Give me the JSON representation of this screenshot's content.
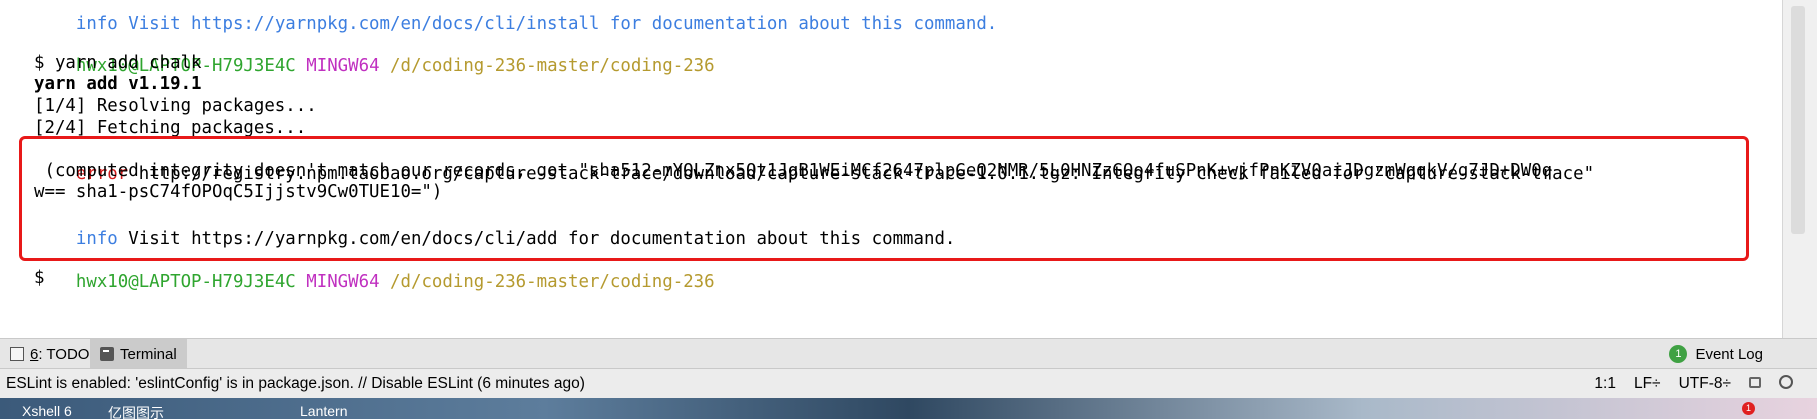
{
  "terminal": {
    "top_partial_line": "info Visit https://yarnpkg.com/en/docs/cli/install for documentation about this command.",
    "prompt1": {
      "user": "hwx10@LAPTOP-H79J3E4C",
      "shell": "MINGW64",
      "path": "/d/coding-236-master/coding-236"
    },
    "command": "$ yarn add chalk",
    "version": "yarn add v1.19.1",
    "step1": "[1/4] Resolving packages...",
    "step2": "[2/4] Fetching packages...",
    "error_label": "error",
    "error_text": " http://registry.npm.taobao.org/capture-stack-trace/download/capture-stack-trace-1.0.1.tgz: Integrity check failed for \"capture-stack-trace\"",
    "error_line2": " (computed integrity doesn't match our records, got \"sha512-mYQLZnx5Qt1JgB1WEiMCf2647plpGeQ2NMR/5L0HNZzGQo4fuSPnK+wjfPnKZV0aiJDgzmWqqkV/g7JD+DW0q",
    "error_line3": "w== sha1-psC74fOPOqC5Ijjstv9Cw0TUE10=\")",
    "info_label": "info",
    "info_text": " Visit https://yarnpkg.com/en/docs/cli/add for documentation about this command.",
    "prompt2": {
      "user": "hwx10@LAPTOP-H79J3E4C",
      "shell": "MINGW64",
      "path": "/d/coding-236-master/coding-236"
    },
    "cursor_prompt": "$"
  },
  "toolwindows": {
    "todo_num": "6",
    "todo_label": ": TODO",
    "terminal_label": "Terminal",
    "event_badge": "1",
    "event_label": "Event Log"
  },
  "statusbar": {
    "message": "ESLint is enabled: 'eslintConfig' is in package.json. // Disable ESLint (6 minutes ago)",
    "position": "1:1",
    "line_sep": "LF÷",
    "encoding": "UTF-8÷"
  },
  "taskbar": {
    "items": [
      "Xshell 6",
      "亿图图示",
      "Lantern"
    ],
    "notif": "1"
  },
  "colors": {
    "prompt_user": "#2fa52f",
    "prompt_shell": "#c030c0",
    "prompt_path": "#b59a2f",
    "error": "#d21c1c",
    "info": "#3c7ee0",
    "highlight_box": "#e81919"
  }
}
